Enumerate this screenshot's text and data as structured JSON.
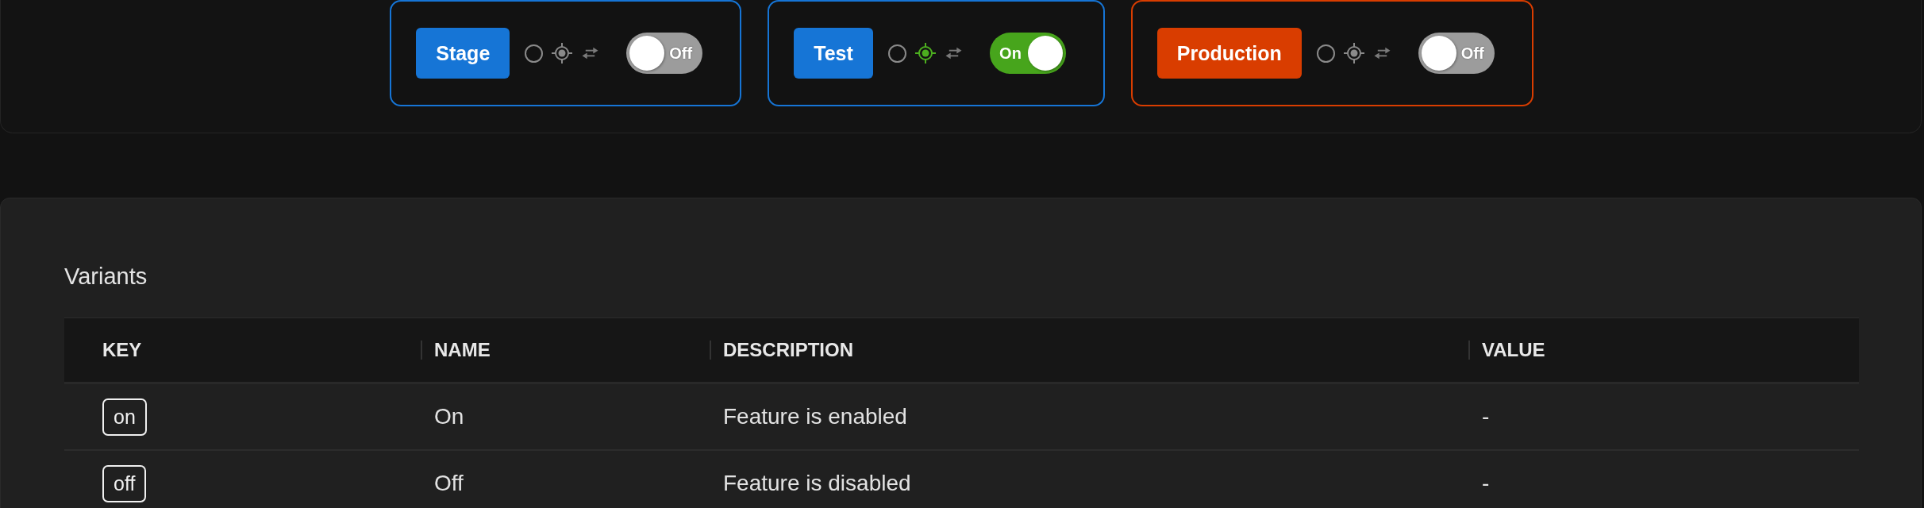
{
  "environments": [
    {
      "name": "Stage",
      "color": "#1675d6",
      "on": false,
      "toggle_label": "Off"
    },
    {
      "name": "Test",
      "color": "#1675d6",
      "on": true,
      "toggle_label": "On"
    },
    {
      "name": "Production",
      "color": "#d93d00",
      "on": false,
      "toggle_label": "Off"
    }
  ],
  "variants": {
    "title": "Variants",
    "columns": [
      "KEY",
      "NAME",
      "DESCRIPTION",
      "VALUE"
    ],
    "rows": [
      {
        "key": "on",
        "name": "On",
        "description": "Feature is enabled",
        "value": "-"
      },
      {
        "key": "off",
        "name": "Off",
        "description": "Feature is disabled",
        "value": "-"
      }
    ]
  }
}
